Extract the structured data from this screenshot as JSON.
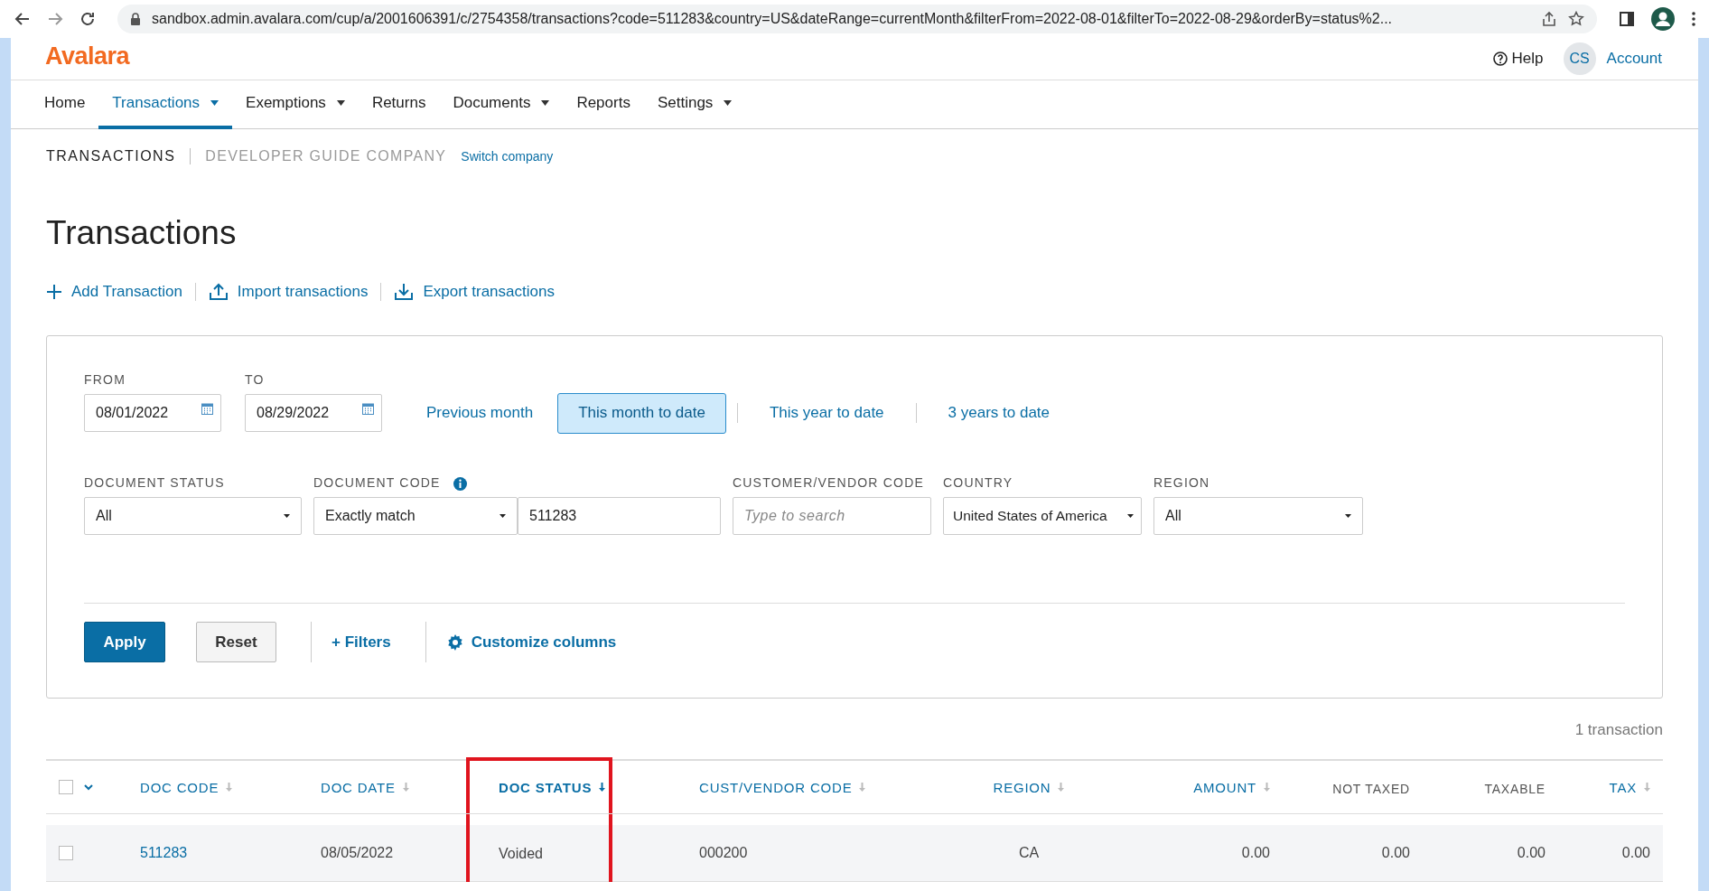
{
  "browser": {
    "url": "sandbox.admin.avalara.com/cup/a/2001606391/c/2754358/transactions?code=511283&country=US&dateRange=currentMonth&filterFrom=2022-08-01&filterTo=2022-08-29&orderBy=status%2..."
  },
  "header": {
    "logo": "Avalara",
    "help": "Help",
    "avatar": "CS",
    "account": "Account"
  },
  "nav": [
    {
      "label": "Home",
      "selected": false,
      "dropdown": false
    },
    {
      "label": "Transactions",
      "selected": true,
      "dropdown": true
    },
    {
      "label": "Exemptions",
      "selected": false,
      "dropdown": true
    },
    {
      "label": "Returns",
      "selected": false,
      "dropdown": false
    },
    {
      "label": "Documents",
      "selected": false,
      "dropdown": true
    },
    {
      "label": "Reports",
      "selected": false,
      "dropdown": false
    },
    {
      "label": "Settings",
      "selected": false,
      "dropdown": true
    }
  ],
  "breadcrumb": {
    "section": "TRANSACTIONS",
    "company": "DEVELOPER GUIDE COMPANY",
    "switch_link": "Switch company"
  },
  "title": "Transactions",
  "actions": [
    {
      "kind": "add",
      "label": "Add Transaction"
    },
    {
      "kind": "import",
      "label": "Import transactions"
    },
    {
      "kind": "export",
      "label": "Export transactions"
    }
  ],
  "filters": {
    "from": {
      "label": "FROM",
      "value": "08/01/2022"
    },
    "to": {
      "label": "TO",
      "value": "08/29/2022"
    },
    "presets": [
      {
        "label": "Previous month",
        "selected": false
      },
      {
        "label": "This month to date",
        "selected": true
      },
      {
        "label": "This year to date",
        "selected": false
      },
      {
        "label": "3 years to date",
        "selected": false
      }
    ],
    "document_status": {
      "label": "DOCUMENT STATUS",
      "value": "All"
    },
    "document_code": {
      "label": "DOCUMENT CODE",
      "match": "Exactly match",
      "value": "511283"
    },
    "customer_vendor_code": {
      "label": "CUSTOMER/VENDOR CODE",
      "placeholder": "Type to search"
    },
    "country": {
      "label": "COUNTRY",
      "value": "United States of America"
    },
    "region": {
      "label": "REGION",
      "value": "All"
    },
    "apply": "Apply",
    "reset": "Reset",
    "more_filters": "+ Filters",
    "customize": "Customize columns"
  },
  "count": "1 transaction",
  "table": {
    "select_all_checked": false,
    "columns": [
      {
        "label": "DOC CODE",
        "sortable": true,
        "sorted": false,
        "highlighted": false
      },
      {
        "label": "DOC DATE",
        "sortable": true,
        "sorted": false,
        "highlighted": false
      },
      {
        "label": "DOC STATUS",
        "sortable": true,
        "sorted": true,
        "highlighted": true
      },
      {
        "label": "CUST/VENDOR CODE",
        "sortable": true,
        "sorted": false,
        "highlighted": false
      },
      {
        "label": "REGION",
        "sortable": true,
        "sorted": false,
        "highlighted": false
      },
      {
        "label": "AMOUNT",
        "sortable": true,
        "sorted": false,
        "highlighted": false
      },
      {
        "label": "NOT TAXED",
        "sortable": false,
        "sorted": false,
        "highlighted": false
      },
      {
        "label": "TAXABLE",
        "sortable": false,
        "sorted": false,
        "highlighted": false
      },
      {
        "label": "TAX",
        "sortable": true,
        "sorted": false,
        "highlighted": false
      }
    ],
    "rows": [
      {
        "checked": false,
        "cells": [
          "511283",
          "08/05/2022",
          "Voided",
          "000200",
          "CA",
          "0.00",
          "0.00",
          "0.00",
          "0.00"
        ]
      }
    ]
  }
}
